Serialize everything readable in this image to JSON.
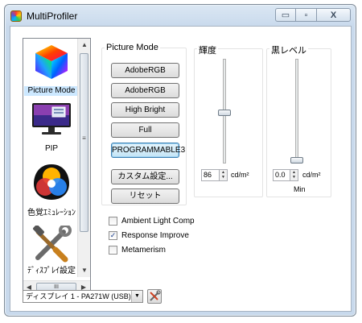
{
  "window": {
    "title": "MultiProfiler",
    "controls": {
      "minimize": "▭",
      "maximize": "▫",
      "close": "X"
    }
  },
  "nav": {
    "items": [
      {
        "label": "Picture Mode",
        "icon": "color-cube-icon",
        "selected": true
      },
      {
        "label": "PIP",
        "icon": "monitor-icon",
        "selected": false
      },
      {
        "label": "色覚ｴﾐｭﾚｰｼｮﾝ",
        "icon": "color-venn-icon",
        "selected": false
      },
      {
        "label": "ﾃﾞｨｽﾌﾟﾚｲ設定",
        "icon": "tools-icon",
        "selected": false
      }
    ],
    "scroll_up": "▲",
    "scroll_down": "▼",
    "scroll_left": "◀",
    "scroll_right": "▶",
    "grip": "≡",
    "hgrip": "III"
  },
  "picture_mode": {
    "title": "Picture Mode",
    "modes": [
      "AdobeRGB",
      "AdobeRGB",
      "High Bright",
      "Full",
      "PROGRAMMABLE3"
    ],
    "active_mode_index": 4,
    "custom_button": "カスタム設定...",
    "reset_button": "リセット"
  },
  "brightness": {
    "title": "輝度",
    "value": "86",
    "unit": "cd/m²",
    "level": 0.48
  },
  "black_level": {
    "title": "黒レベル",
    "value": "0.0",
    "unit": "cd/m²",
    "caption": "Min",
    "level": 0.0
  },
  "options": [
    {
      "label": "Ambient Light Comp",
      "checked": false,
      "mark": ""
    },
    {
      "label": "Response Improve",
      "checked": true,
      "mark": "✓"
    },
    {
      "label": "Metamerism",
      "checked": false,
      "mark": ""
    }
  ],
  "display_select": {
    "value": "ディスプレイ 1 - PA271W (USB)",
    "drop": "▼"
  },
  "colors": {
    "active_button_border": "#3c7fb1",
    "selection": "#cce8ff"
  }
}
